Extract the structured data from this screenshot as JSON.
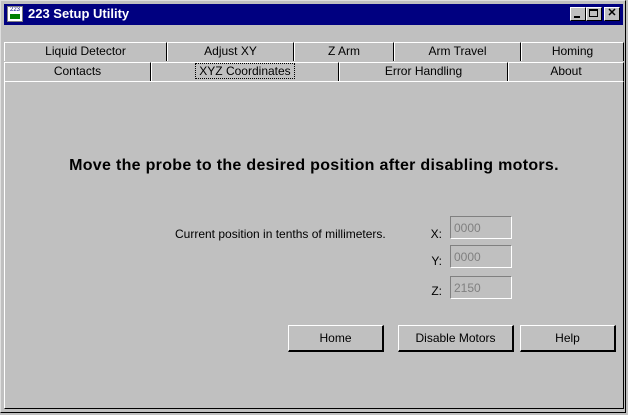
{
  "window": {
    "title": "223 Setup Utility",
    "icon_text": "223",
    "icon_name": "app-icon"
  },
  "caption_buttons": {
    "minimize": "minimize-icon",
    "maximize": "maximize-icon",
    "close": "close-icon",
    "close_glyph": "✕"
  },
  "tabs": {
    "row1": [
      "Liquid Detector",
      "Adjust XY",
      "Z Arm",
      "Arm Travel",
      "Homing"
    ],
    "row2": [
      "Contacts",
      "XYZ Coordinates",
      "Error Handling",
      "About"
    ],
    "selected": "XYZ Coordinates"
  },
  "panel": {
    "instruction": "Move the probe to the desired position after disabling motors.",
    "position_label": "Current position in tenths of millimeters.",
    "x_label": "X:",
    "x_value": "0000",
    "y_label": "Y:",
    "y_value": "0000",
    "z_label": "Z:",
    "z_value": "2150"
  },
  "buttons": {
    "home": "Home",
    "disable_motors": "Disable Motors",
    "help": "Help"
  },
  "colors": {
    "face": "#c0c0c0",
    "titlebar": "#000080",
    "disabled_text": "#808080"
  }
}
